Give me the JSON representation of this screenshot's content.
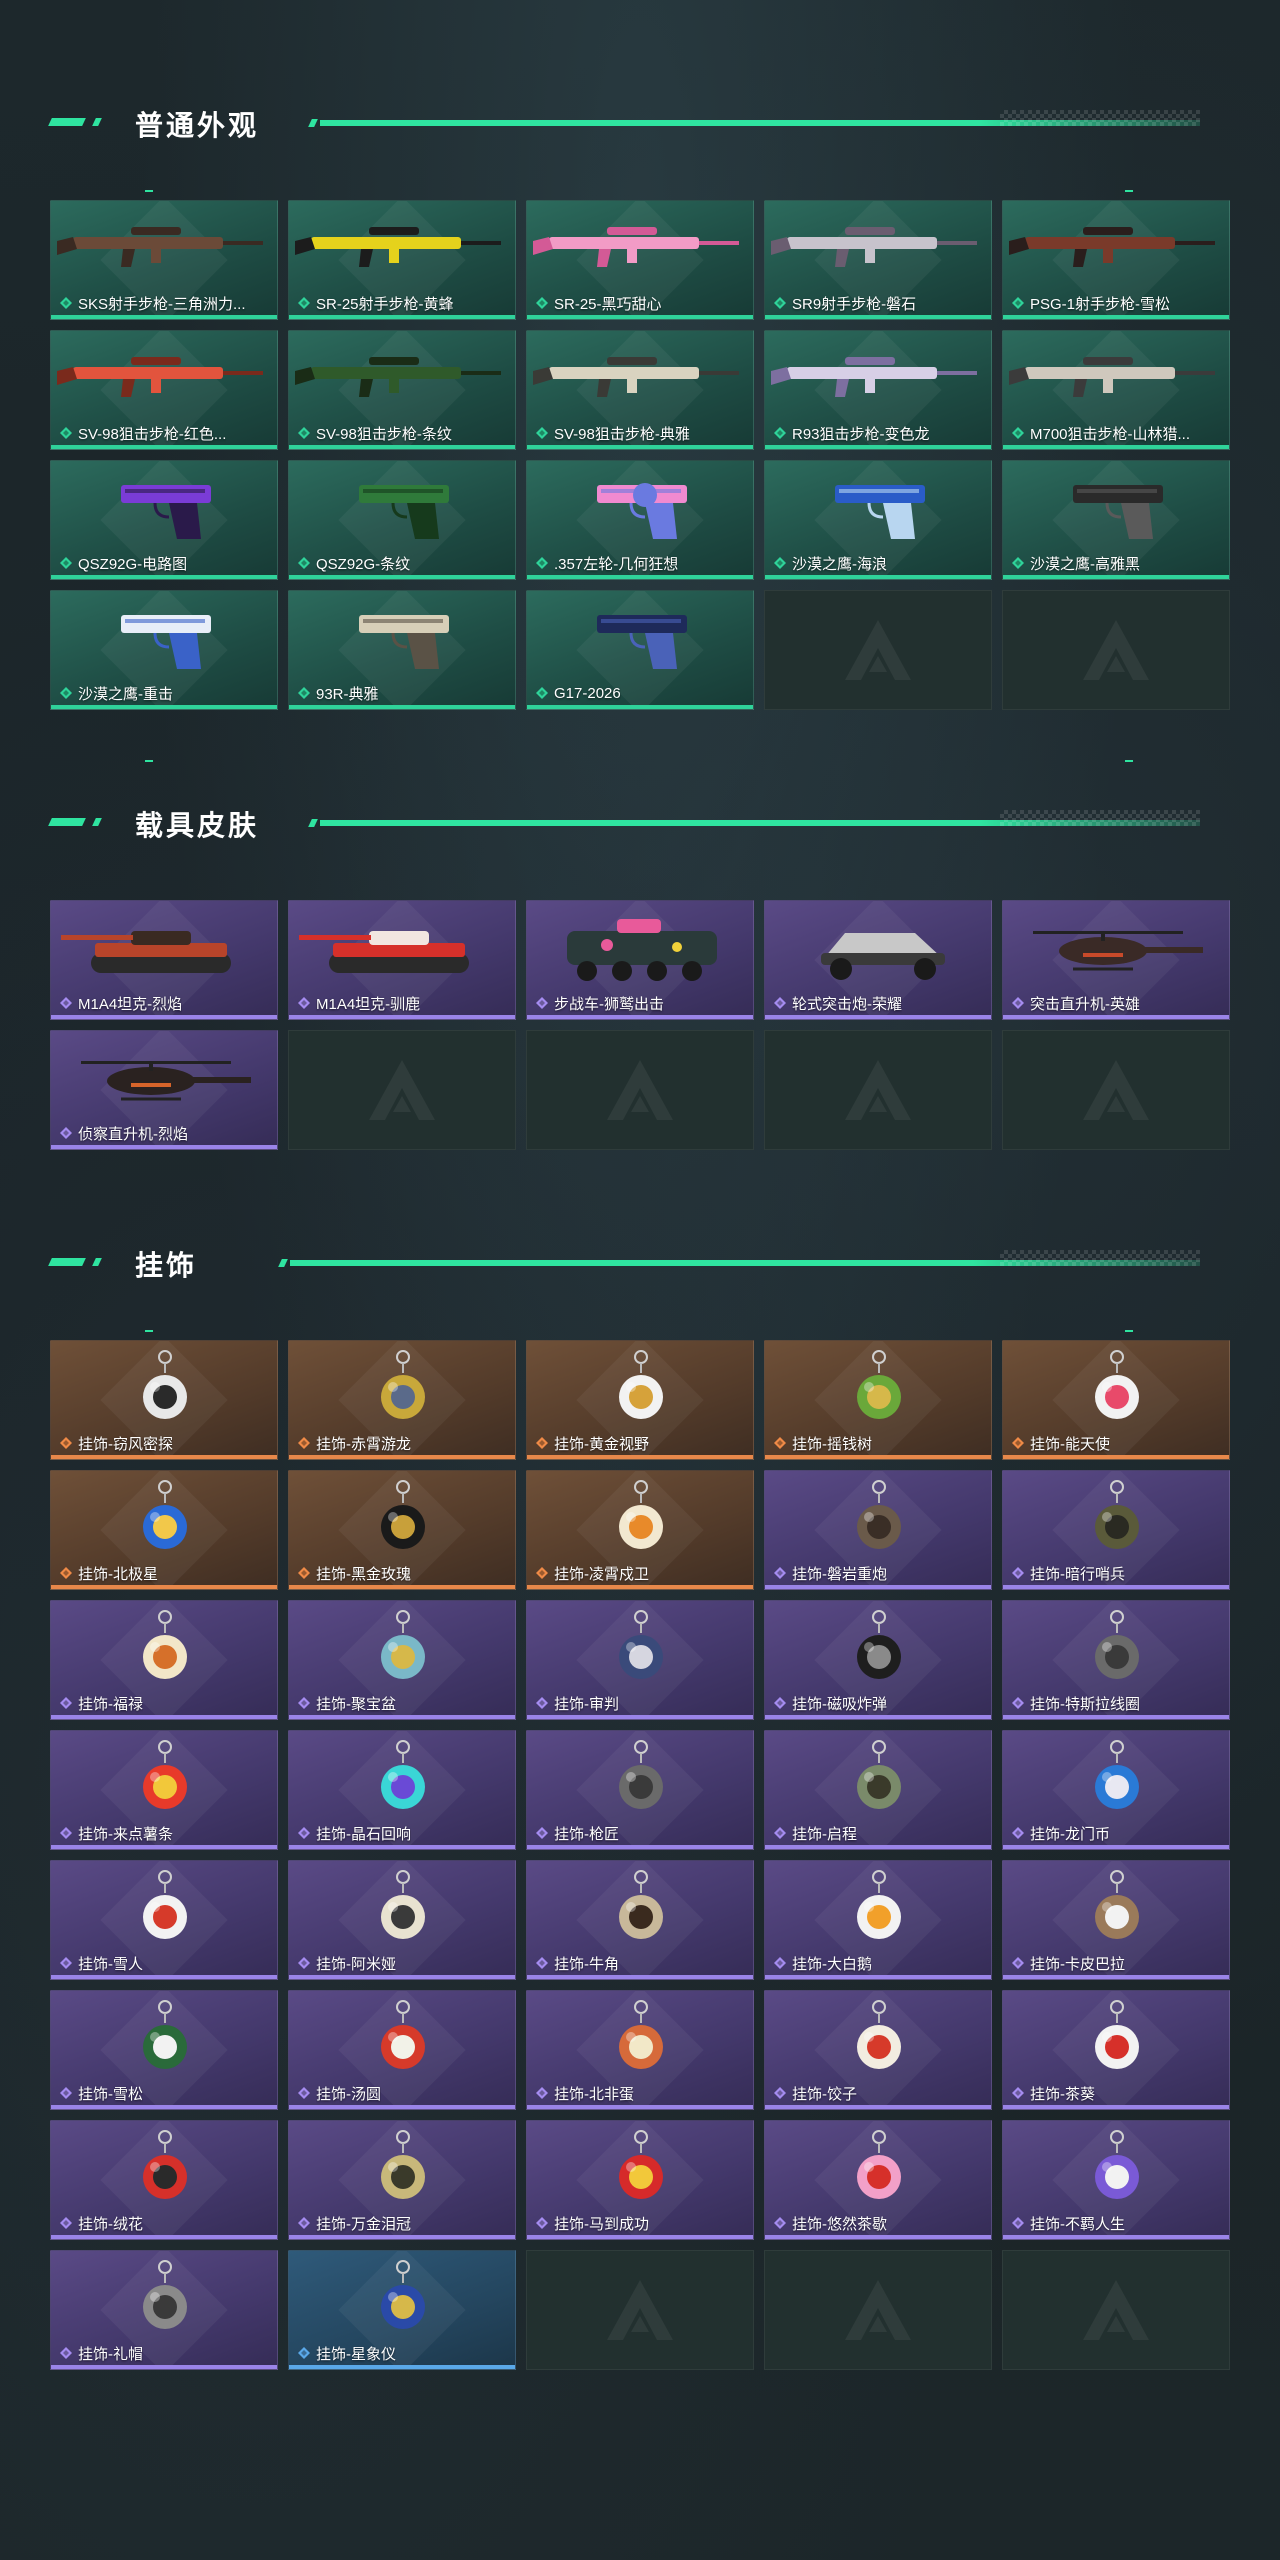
{
  "sections": {
    "gun_skins": {
      "title": "普通外观",
      "items": [
        {
          "name": "SKS射手步枪-三角洲力...",
          "rarity": "green",
          "kind": "rifle",
          "colors": [
            "#6b4a38",
            "#3a2a22"
          ]
        },
        {
          "name": "SR-25射手步枪-黄蜂",
          "rarity": "green",
          "kind": "rifle",
          "colors": [
            "#e5d21c",
            "#1c1c1c"
          ]
        },
        {
          "name": "SR-25-黑巧甜心",
          "rarity": "green",
          "kind": "rifle",
          "colors": [
            "#f29bc6",
            "#d35a96"
          ]
        },
        {
          "name": "SR9射手步枪-磐石",
          "rarity": "green",
          "kind": "rifle",
          "colors": [
            "#c7c3cc",
            "#6a5d70"
          ]
        },
        {
          "name": "PSG-1射手步枪-雪松",
          "rarity": "green",
          "kind": "rifle",
          "colors": [
            "#7a3a2a",
            "#2a1e1c"
          ]
        },
        {
          "name": "SV-98狙击步枪-红色...",
          "rarity": "green",
          "kind": "rifle",
          "colors": [
            "#e2543d",
            "#7a2a1c"
          ]
        },
        {
          "name": "SV-98狙击步枪-条纹",
          "rarity": "green",
          "kind": "rifle",
          "colors": [
            "#2f5a2a",
            "#1a2c16"
          ]
        },
        {
          "name": "SV-98狙击步枪-典雅",
          "rarity": "green",
          "kind": "rifle",
          "colors": [
            "#d9d3c0",
            "#3a3a36"
          ]
        },
        {
          "name": "R93狙击步枪-变色龙",
          "rarity": "green",
          "kind": "rifle",
          "colors": [
            "#d7cfe6",
            "#7d6fa0"
          ]
        },
        {
          "name": "M700狙击步枪-山林猎...",
          "rarity": "green",
          "kind": "rifle",
          "colors": [
            "#cfc8bd",
            "#3b3b3b"
          ]
        },
        {
          "name": "QSZ92G-电路图",
          "rarity": "green",
          "kind": "pistol",
          "colors": [
            "#7a3cd6",
            "#2a1a4a"
          ]
        },
        {
          "name": "QSZ92G-条纹",
          "rarity": "green",
          "kind": "pistol",
          "colors": [
            "#2f7a3a",
            "#163a1c"
          ]
        },
        {
          "name": ".357左轮-几何狂想",
          "rarity": "green",
          "kind": "revolver",
          "colors": [
            "#f08ad0",
            "#6a7ae0"
          ]
        },
        {
          "name": "沙漠之鹰-海浪",
          "rarity": "green",
          "kind": "pistol",
          "colors": [
            "#2a5cc8",
            "#b8d6f0"
          ]
        },
        {
          "name": "沙漠之鹰-高雅黑",
          "rarity": "green",
          "kind": "pistol",
          "colors": [
            "#2a2a2a",
            "#5a5a5a"
          ]
        },
        {
          "name": "沙漠之鹰-重击",
          "rarity": "green",
          "kind": "pistol",
          "colors": [
            "#e8eef8",
            "#3a62c8"
          ]
        },
        {
          "name": "93R-典雅",
          "rarity": "green",
          "kind": "pistol",
          "colors": [
            "#d7cfb8",
            "#5a5246"
          ]
        },
        {
          "name": "G17-2026",
          "rarity": "green",
          "kind": "pistol",
          "colors": [
            "#1e2a5a",
            "#4a62b8"
          ]
        },
        {
          "empty": true
        },
        {
          "empty": true
        }
      ]
    },
    "vehicle_skins": {
      "title": "载具皮肤",
      "items": [
        {
          "name": "M1A4坦克-烈焰",
          "rarity": "purple",
          "kind": "tank",
          "colors": [
            "#b8442a",
            "#3a2a22"
          ]
        },
        {
          "name": "M1A4坦克-驯鹿",
          "rarity": "purple",
          "kind": "tank",
          "colors": [
            "#d6302a",
            "#f2e6e0"
          ]
        },
        {
          "name": "步战车-狮鹫出击",
          "rarity": "purple",
          "kind": "apc",
          "colors": [
            "#2a3a3a",
            "#e85a9a"
          ]
        },
        {
          "name": "轮式突击炮-荣耀",
          "rarity": "purple",
          "kind": "buggy",
          "colors": [
            "#c8c8c8",
            "#3a3a3a"
          ]
        },
        {
          "name": "突击直升机-英雄",
          "rarity": "purple",
          "kind": "heli",
          "colors": [
            "#3a2a26",
            "#c84a2a"
          ]
        },
        {
          "name": "侦察直升机-烈焰",
          "rarity": "purple",
          "kind": "heli",
          "colors": [
            "#2a2220",
            "#d6642a"
          ]
        },
        {
          "empty": true
        },
        {
          "empty": true
        },
        {
          "empty": true
        },
        {
          "empty": true
        }
      ]
    },
    "charms": {
      "title": "挂饰",
      "items": [
        {
          "name": "挂饰-窃风密探",
          "rarity": "orange",
          "kind": "charm",
          "colors": [
            "#e8e8e8",
            "#2a2a2a"
          ]
        },
        {
          "name": "挂饰-赤霄游龙",
          "rarity": "orange",
          "kind": "charm",
          "colors": [
            "#c8a83a",
            "#5a6a8a"
          ]
        },
        {
          "name": "挂饰-黄金视野",
          "rarity": "orange",
          "kind": "charm",
          "colors": [
            "#f2f2f2",
            "#d6a23a"
          ]
        },
        {
          "name": "挂饰-摇钱树",
          "rarity": "orange",
          "kind": "charm",
          "colors": [
            "#6aa83a",
            "#d6b84a"
          ]
        },
        {
          "name": "挂饰-能天使",
          "rarity": "orange",
          "kind": "charm",
          "colors": [
            "#f2f2f2",
            "#e84a6a"
          ]
        },
        {
          "name": "挂饰-北极星",
          "rarity": "orange",
          "kind": "charm",
          "colors": [
            "#2a6ad6",
            "#f2c84a"
          ]
        },
        {
          "name": "挂饰-黑金玫瑰",
          "rarity": "orange",
          "kind": "charm",
          "colors": [
            "#1a1a1a",
            "#c8a03a"
          ]
        },
        {
          "name": "挂饰-凌霄戍卫",
          "rarity": "orange",
          "kind": "charm",
          "colors": [
            "#f2e8d0",
            "#e88a2a"
          ]
        },
        {
          "name": "挂饰-磐岩重炮",
          "rarity": "purple",
          "kind": "charm",
          "colors": [
            "#6a5a4a",
            "#3a2e26"
          ]
        },
        {
          "name": "挂饰-暗行哨兵",
          "rarity": "purple",
          "kind": "charm",
          "colors": [
            "#5a5a3a",
            "#2a2a22"
          ]
        },
        {
          "name": "挂饰-福禄",
          "rarity": "purple",
          "kind": "charm",
          "colors": [
            "#f2e6c8",
            "#d6702a"
          ]
        },
        {
          "name": "挂饰-聚宝盆",
          "rarity": "purple",
          "kind": "charm",
          "colors": [
            "#7ab8c8",
            "#d6b84a"
          ]
        },
        {
          "name": "挂饰-审判",
          "rarity": "purple",
          "kind": "charm",
          "colors": [
            "#3a4a7a",
            "#d6d6e0"
          ]
        },
        {
          "name": "挂饰-磁吸炸弹",
          "rarity": "purple",
          "kind": "charm",
          "colors": [
            "#1e1e1e",
            "#8a8a8a"
          ]
        },
        {
          "name": "挂饰-特斯拉线圈",
          "rarity": "purple",
          "kind": "charm",
          "colors": [
            "#6a6a6a",
            "#3a3a3a"
          ]
        },
        {
          "name": "挂饰-来点薯条",
          "rarity": "purple",
          "kind": "charm",
          "colors": [
            "#e83a2a",
            "#f2c83a"
          ]
        },
        {
          "name": "挂饰-晶石回响",
          "rarity": "purple",
          "kind": "charm",
          "colors": [
            "#3ad6d6",
            "#6a4ad6"
          ]
        },
        {
          "name": "挂饰-枪匠",
          "rarity": "purple",
          "kind": "charm",
          "colors": [
            "#6a6a6a",
            "#3a3a3a"
          ]
        },
        {
          "name": "挂饰-启程",
          "rarity": "purple",
          "kind": "charm",
          "colors": [
            "#7a8a6a",
            "#3a3a2a"
          ]
        },
        {
          "name": "挂饰-龙门币",
          "rarity": "purple",
          "kind": "charm",
          "colors": [
            "#2a7ad6",
            "#e8e8f2"
          ]
        },
        {
          "name": "挂饰-雪人",
          "rarity": "purple",
          "kind": "charm",
          "colors": [
            "#f2f2f2",
            "#d63a2a"
          ]
        },
        {
          "name": "挂饰-阿米娅",
          "rarity": "purple",
          "kind": "charm",
          "colors": [
            "#e8e2d0",
            "#3a3a3a"
          ]
        },
        {
          "name": "挂饰-牛角",
          "rarity": "purple",
          "kind": "charm",
          "colors": [
            "#c8b89a",
            "#3a2a1e"
          ]
        },
        {
          "name": "挂饰-大白鹅",
          "rarity": "purple",
          "kind": "charm",
          "colors": [
            "#f2f2f2",
            "#f2a02a"
          ]
        },
        {
          "name": "挂饰-卡皮巴拉",
          "rarity": "purple",
          "kind": "charm",
          "colors": [
            "#9a7a5a",
            "#f2f2f2"
          ]
        },
        {
          "name": "挂饰-雪松",
          "rarity": "purple",
          "kind": "charm",
          "colors": [
            "#2a6a3a",
            "#f2f2f2"
          ]
        },
        {
          "name": "挂饰-汤圆",
          "rarity": "purple",
          "kind": "charm",
          "colors": [
            "#d63a2a",
            "#f2f2e8"
          ]
        },
        {
          "name": "挂饰-北非蛋",
          "rarity": "purple",
          "kind": "charm",
          "colors": [
            "#d66a3a",
            "#f2e8c8"
          ]
        },
        {
          "name": "挂饰-饺子",
          "rarity": "purple",
          "kind": "charm",
          "colors": [
            "#f2ece0",
            "#d63a2a"
          ]
        },
        {
          "name": "挂饰-茶葵",
          "rarity": "purple",
          "kind": "charm",
          "colors": [
            "#f2f2f2",
            "#d6302a"
          ]
        },
        {
          "name": "挂饰-绒花",
          "rarity": "purple",
          "kind": "charm",
          "colors": [
            "#d6302a",
            "#2a2a2a"
          ]
        },
        {
          "name": "挂饰-万金泪冠",
          "rarity": "purple",
          "kind": "charm",
          "colors": [
            "#c8b87a",
            "#3a3a2a"
          ]
        },
        {
          "name": "挂饰-马到成功",
          "rarity": "purple",
          "kind": "charm",
          "colors": [
            "#d62a2a",
            "#f2c83a"
          ]
        },
        {
          "name": "挂饰-悠然茶歇",
          "rarity": "purple",
          "kind": "charm",
          "colors": [
            "#f2a0c8",
            "#d6302a"
          ]
        },
        {
          "name": "挂饰-不羁人生",
          "rarity": "purple",
          "kind": "charm",
          "colors": [
            "#7a5ad6",
            "#f2f2f2"
          ]
        },
        {
          "name": "挂饰-礼帽",
          "rarity": "purple",
          "kind": "charm",
          "colors": [
            "#8a8a8a",
            "#3a3a3a"
          ]
        },
        {
          "name": "挂饰-星象仪",
          "rarity": "blue",
          "kind": "charm",
          "colors": [
            "#2a4aa8",
            "#d6b84a"
          ]
        },
        {
          "empty": true
        },
        {
          "empty": true
        },
        {
          "empty": true
        }
      ]
    }
  },
  "rarity_colors": {
    "green": "#2fd39a",
    "purple": "#a58cf0",
    "orange": "#ef8a47",
    "blue": "#5aa8e8"
  },
  "accent_color": "#2fe4a0"
}
